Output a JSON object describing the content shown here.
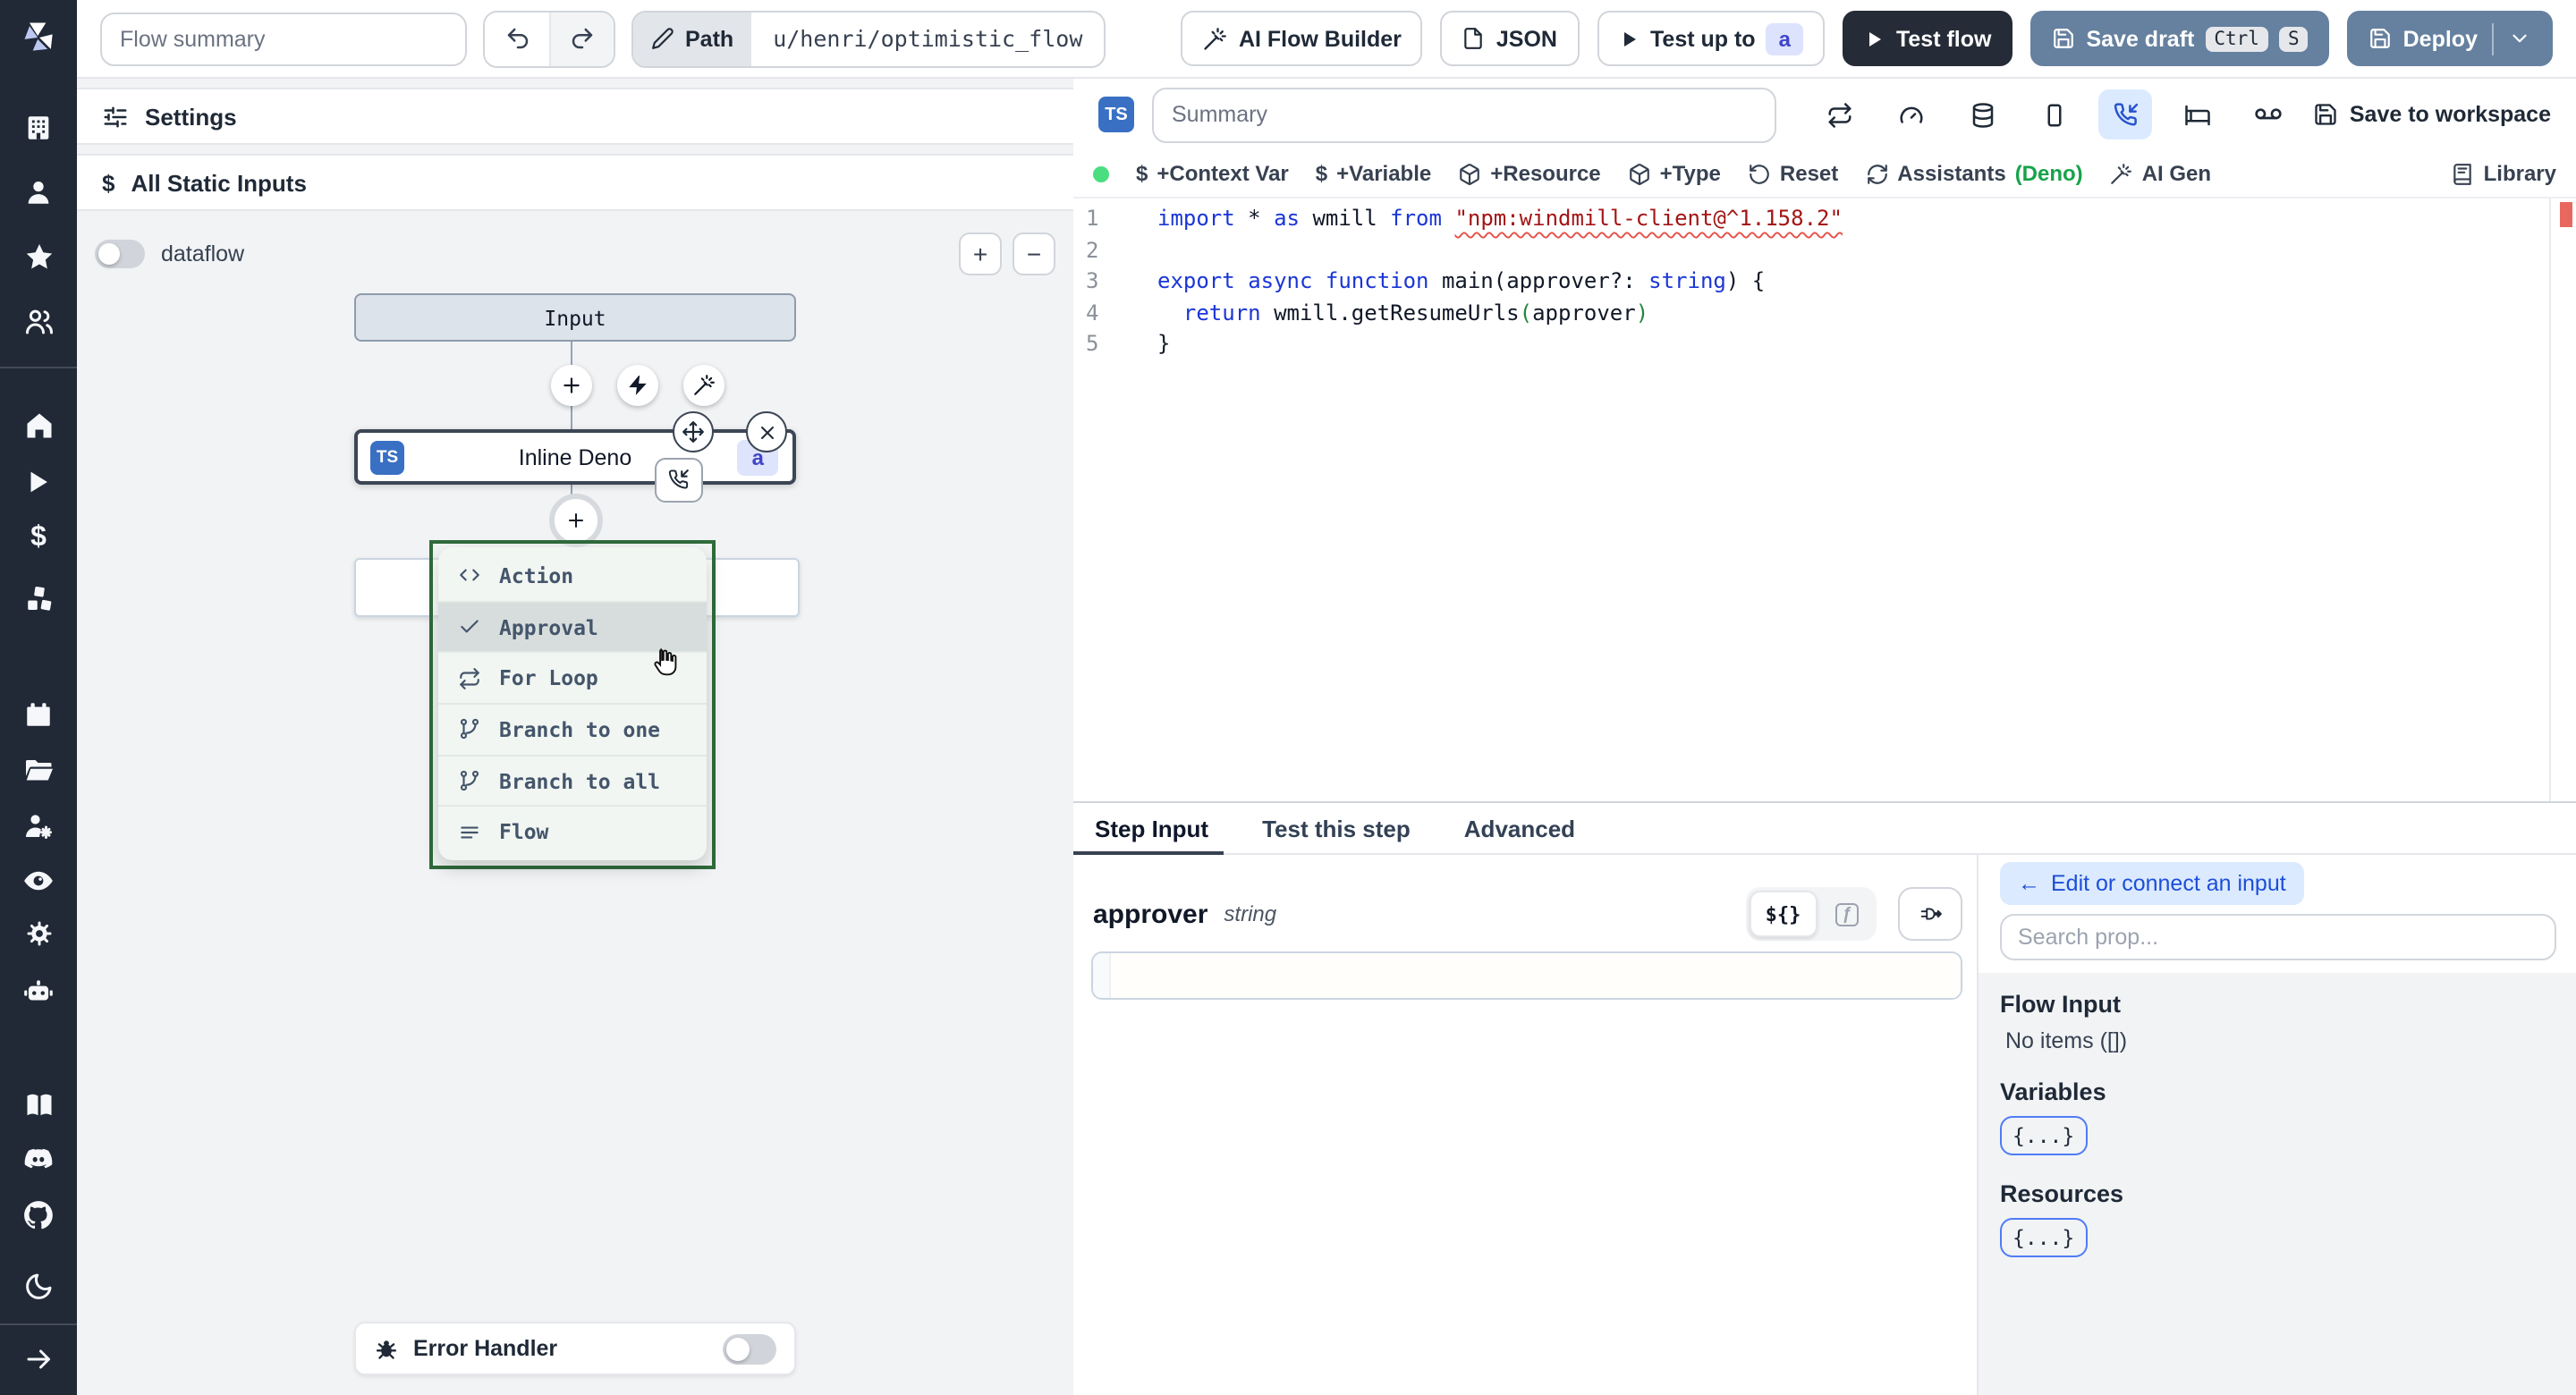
{
  "topbar": {
    "flow_summary_placeholder": "Flow summary",
    "path_label": "Path",
    "path_value": "u/henri/optimistic_flow",
    "ai_flow_builder": "AI Flow Builder",
    "json_label": "JSON",
    "test_up_to": "Test up to",
    "test_up_to_badge": "a",
    "test_flow": "Test flow",
    "save_draft": "Save draft",
    "kbd_ctrl": "Ctrl",
    "kbd_s": "S",
    "deploy": "Deploy"
  },
  "sidebar": {
    "icons": [
      "windmill-logo",
      "building",
      "user",
      "star",
      "users",
      "home",
      "play",
      "dollar",
      "boxes",
      "calendar",
      "folder-open",
      "user-cog",
      "eye",
      "gear",
      "bot",
      "book-open",
      "discord",
      "github",
      "moon",
      "arrow-right"
    ]
  },
  "flow": {
    "settings": "Settings",
    "all_static_inputs": "All Static Inputs",
    "dataflow": "dataflow",
    "zoom_in": "+",
    "zoom_out": "−",
    "input_node": "Input",
    "node": {
      "lang": "TS",
      "label": "Inline Deno",
      "badge": "a"
    },
    "menu": {
      "items": [
        {
          "label": "Action",
          "icon": "code-icon"
        },
        {
          "label": "Approval",
          "icon": "check-icon"
        },
        {
          "label": "For Loop",
          "icon": "repeat-icon"
        },
        {
          "label": "Branch to one",
          "icon": "git-branch-icon"
        },
        {
          "label": "Branch to all",
          "icon": "git-branch-icon"
        },
        {
          "label": "Flow",
          "icon": "menu-icon"
        }
      ]
    },
    "error_handler": "Error Handler"
  },
  "editor": {
    "lang_badge": "TS",
    "summary_placeholder": "Summary",
    "save_to_workspace": "Save to workspace",
    "bar": {
      "dollar": "$",
      "context_var": "+Context Var",
      "variable": "+Variable",
      "resource": "+Resource",
      "type": "+Type",
      "reset": "Reset",
      "assistants": "Assistants",
      "assistants_lang": "(Deno)",
      "ai_gen": "AI Gen",
      "library": "Library"
    },
    "code": {
      "lines": [
        {
          "num": "1",
          "tokens": [
            {
              "t": "import",
              "c": "kw"
            },
            {
              "t": " * ",
              "c": "pl"
            },
            {
              "t": "as",
              "c": "kw"
            },
            {
              "t": " wmill ",
              "c": "pl"
            },
            {
              "t": "from",
              "c": "kw"
            },
            {
              "t": " ",
              "c": "pl"
            },
            {
              "t": "\"npm:windmill-client@^1.158.2\"",
              "c": "str squiggle"
            }
          ]
        },
        {
          "num": "2",
          "tokens": []
        },
        {
          "num": "3",
          "tokens": [
            {
              "t": "export",
              "c": "kw"
            },
            {
              "t": " ",
              "c": "pl"
            },
            {
              "t": "async",
              "c": "kw"
            },
            {
              "t": " ",
              "c": "pl"
            },
            {
              "t": "function",
              "c": "kw"
            },
            {
              "t": " main(approver?: ",
              "c": "pl"
            },
            {
              "t": "string",
              "c": "kw"
            },
            {
              "t": ") {",
              "c": "pl"
            }
          ]
        },
        {
          "num": "4",
          "tokens": [
            {
              "t": "  ",
              "c": "pl"
            },
            {
              "t": "return",
              "c": "kw"
            },
            {
              "t": " wmill.getResumeUrls",
              "c": "pl"
            },
            {
              "t": "(",
              "c": "par"
            },
            {
              "t": "approver",
              "c": "pl"
            },
            {
              "t": ")",
              "c": "par"
            }
          ]
        },
        {
          "num": "5",
          "tokens": [
            {
              "t": "}",
              "c": "pl"
            }
          ]
        }
      ]
    }
  },
  "step": {
    "tabs": [
      {
        "label": "Step Input"
      },
      {
        "label": "Test this step"
      },
      {
        "label": "Advanced"
      }
    ],
    "field_name": "approver",
    "field_type": "string",
    "seg_json": "${}",
    "seg_fn": "ƒ"
  },
  "connect": {
    "back_arrow": "←",
    "edit_or_connect": "Edit or connect an input",
    "search_placeholder": "Search prop...",
    "flow_input": "Flow Input",
    "no_items": "No items ([])",
    "variables": "Variables",
    "resources": "Resources",
    "braces": "{...}"
  },
  "colors": {
    "sidebar_bg": "#212836",
    "button_blue": "#66819f",
    "button_dark": "#252b37",
    "ts_badge_blue": "#3970c4",
    "id_badge_bg": "#dfe4fd",
    "id_badge_text": "#4145c8",
    "menu_border_green": "#2f6b3c",
    "deno_green": "#16a34a",
    "active_icon_blue": "#2953cc",
    "error_marker_red": "#e8685f",
    "run_dot_green": "#4ade80"
  }
}
